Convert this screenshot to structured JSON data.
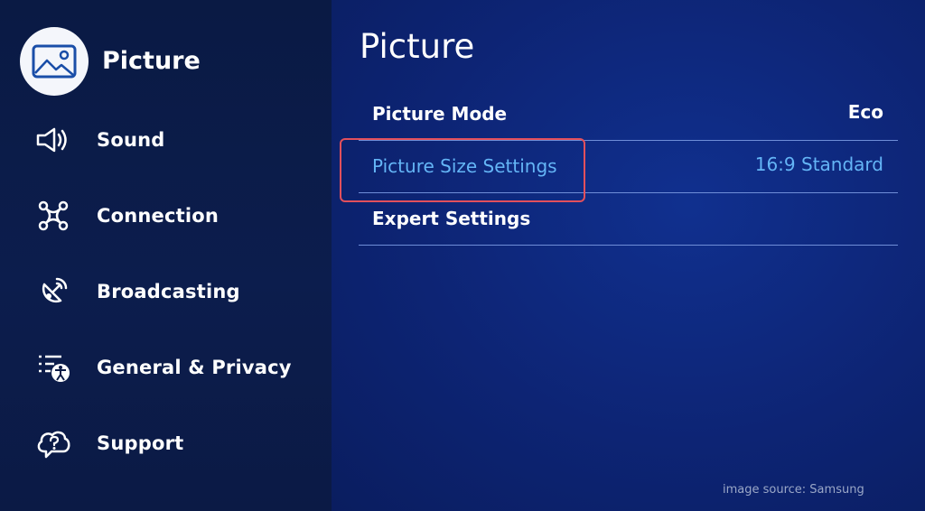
{
  "sidebar": {
    "active": {
      "label": "Picture",
      "icon": "picture-icon"
    },
    "items": [
      {
        "label": "Sound",
        "icon": "sound-icon"
      },
      {
        "label": "Connection",
        "icon": "connection-icon"
      },
      {
        "label": "Broadcasting",
        "icon": "broadcasting-icon"
      },
      {
        "label": "General & Privacy",
        "icon": "general-privacy-icon"
      },
      {
        "label": "Support",
        "icon": "support-icon"
      }
    ]
  },
  "main": {
    "title": "Picture",
    "rows": [
      {
        "label": "Picture Mode",
        "value": "Eco"
      },
      {
        "label": "Picture Size Settings",
        "value": "16:9 Standard",
        "highlighted": true
      },
      {
        "label": "Expert Settings",
        "value": ""
      }
    ]
  },
  "footer": {
    "source": "image source: Samsung"
  },
  "colors": {
    "sidebar_bg": "#0b1a45",
    "main_bg": "#0d2474",
    "highlight_text": "#64b5f6",
    "annotation_box": "#e2505c",
    "divider": "#6f8ed8"
  }
}
